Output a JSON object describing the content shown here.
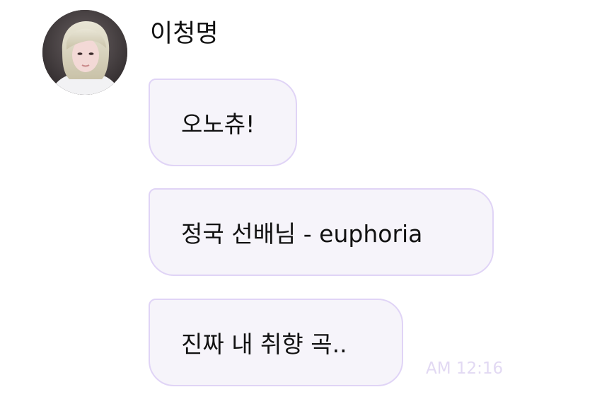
{
  "sender": {
    "name": "이청명"
  },
  "messages": [
    {
      "text": "오노츄!"
    },
    {
      "text": "정국 선배님 - euphoria"
    },
    {
      "text": "진짜 내 취향 곡.."
    }
  ],
  "timestamp": "AM 12:16",
  "colors": {
    "bubble_border": "#e0d4f6",
    "bubble_fill": "#f6f4fa",
    "timestamp": "#e2d9f3",
    "text": "#111111"
  }
}
